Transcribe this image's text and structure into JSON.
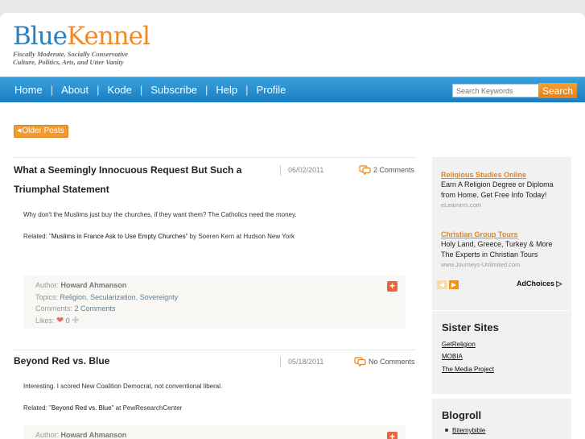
{
  "site": {
    "logo_part1": "Blue",
    "logo_part2": "Kennel",
    "tagline_line1": "Fiscally Moderate, Socially Conservative",
    "tagline_line2": "Culture, Politics, Arts, and Utter Vanity"
  },
  "nav": {
    "items": [
      "Home",
      "About",
      "Kode",
      "Subscribe",
      "Help",
      "Profile"
    ],
    "separator": "|",
    "search_placeholder": "Search Keywords",
    "search_button": "Search"
  },
  "older_posts": {
    "arrow": "◀",
    "label": "Older Posts"
  },
  "posts": [
    {
      "title_line1": "What a Seemingly Innocuous Request But Such a",
      "title_line2": "Triumphal Statement",
      "date": "06/02/2011",
      "comments": "2 Comments",
      "text": "Why don't the Muslims just buy the churches, if they want them?  The Catholics need the money.",
      "related_prefix": "Related: \"",
      "related_link": "Muslims in France Ask to Use Empty Churches",
      "related_suffix": "\" by Soeren Kern at Hudson New York",
      "author_label": "Author: ",
      "author": "Howard Ahmanson",
      "topics_label": "Topics: ",
      "topics": [
        "Religion",
        "Secularization",
        "Sovereignty"
      ],
      "comments_label": "Comments: ",
      "comments_link": "2 Comments",
      "likes_label": "Likes: ",
      "likes": "0"
    },
    {
      "title_line1": "Beyond Red vs. Blue",
      "date": "05/18/2011",
      "comments": "No Comments",
      "text": "Interesting.  I scored New Coalition Democrat, not conventional liberal.",
      "related_prefix": "Related: \"",
      "related_link": "Beyond Red vs. Blue",
      "related_suffix": "\" at PewResearchCenter",
      "author_label": "Author: ",
      "author": "Howard Ahmanson"
    }
  ],
  "ads": [
    {
      "title": "Religious Studies Online",
      "line1": "Earn A Religion Degree or Diploma",
      "line2": "from Home. Get Free Info Today!",
      "url": "eLearners.com"
    },
    {
      "title": "Christian Group Tours",
      "line1": "Holy Land, Greece, Turkey & More",
      "line2": "The Experts in Christian Tours",
      "url": "www.Journeys-Unlimited.com"
    }
  ],
  "adchoices": "AdChoices ▷",
  "sister_sites": {
    "heading": "Sister Sites",
    "links": [
      "GetReligion",
      "MOBIA",
      "The Media Project"
    ]
  },
  "blogroll": {
    "heading": "Blogroll",
    "links": [
      "Bitemybible"
    ]
  },
  "colors": {
    "accent_blue": "#1a7fc2",
    "accent_orange": "#f39a2e",
    "plus_red": "#e8663c"
  },
  "icons": [
    "comment-bubble-icon",
    "plus-icon",
    "heart-icon",
    "left-arrow-icon",
    "right-arrow-icon"
  ]
}
